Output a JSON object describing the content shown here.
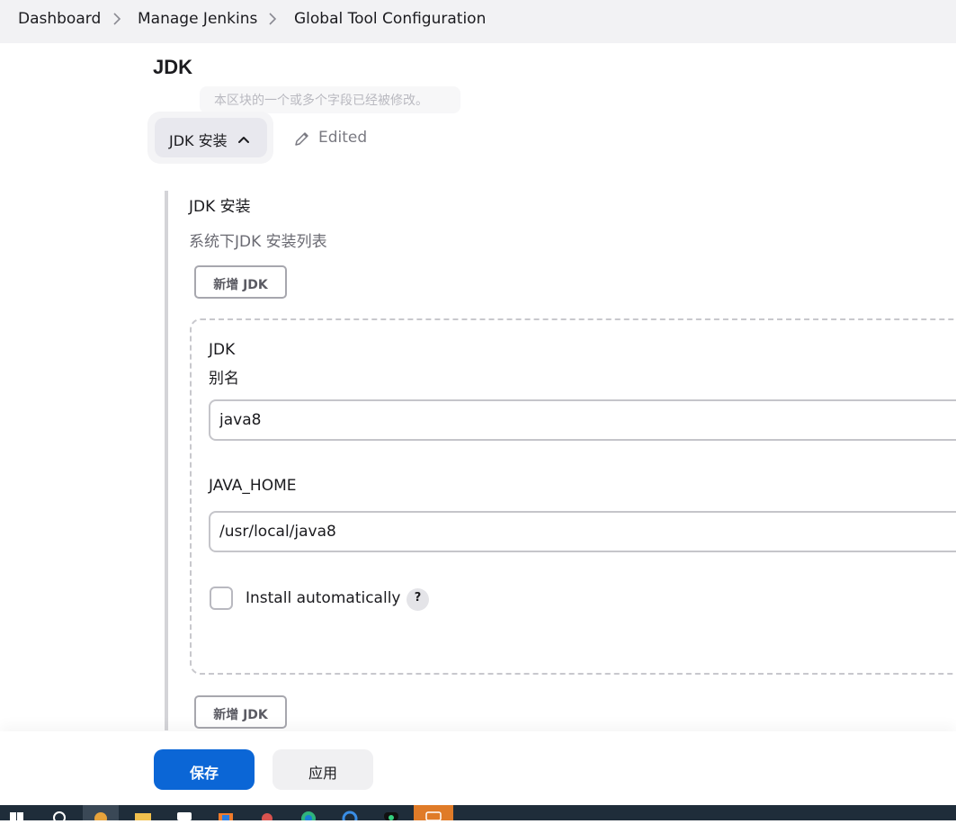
{
  "breadcrumb": {
    "items": [
      "Dashboard",
      "Manage Jenkins",
      "Global Tool Configuration"
    ]
  },
  "section": {
    "title": "JDK",
    "tooltip": "本区块的一个或多个字段已经被修改。",
    "dropdown_label": "JDK 安装",
    "edited_label": "Edited"
  },
  "installations": {
    "title": "JDK 安装",
    "description": "系统下JDK 安装列表",
    "add_label": "新增 JDK",
    "items": [
      {
        "name_label_line1": "JDK",
        "name_label_line2": "别名",
        "name_value": "java8",
        "home_label": "JAVA_HOME",
        "home_value": "/usr/local/java8",
        "auto_label": "Install automatically",
        "auto_checked": false,
        "help": "?"
      }
    ]
  },
  "footer": {
    "save_label": "保存",
    "apply_label": "应用"
  },
  "colors": {
    "primary": "#0b66d6",
    "breadcrumb_bg": "#f2f2f4",
    "taskbar": "#1f2d3a"
  }
}
